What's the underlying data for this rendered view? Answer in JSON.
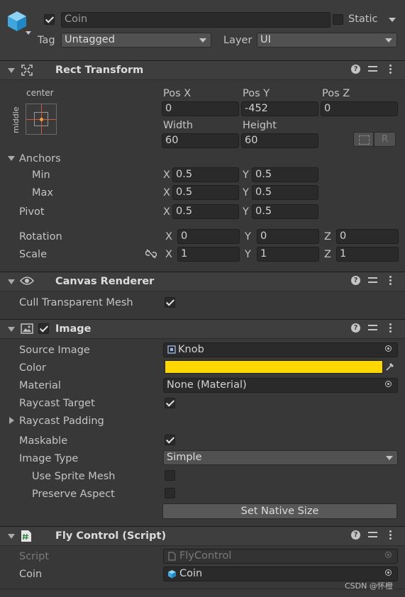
{
  "object": {
    "name": "Coin",
    "static_label": "Static",
    "tag_label": "Tag",
    "tag_value": "Untagged",
    "layer_label": "Layer",
    "layer_value": "UI"
  },
  "rect_transform": {
    "title": "Rect Transform",
    "anchor_preset_h": "center",
    "anchor_preset_v": "middle",
    "pos_x_label": "Pos X",
    "pos_x": "0",
    "pos_y_label": "Pos Y",
    "pos_y": "-452",
    "pos_z_label": "Pos Z",
    "pos_z": "0",
    "width_label": "Width",
    "width": "60",
    "height_label": "Height",
    "height": "60",
    "raw_edit_label": "R",
    "anchors_label": "Anchors",
    "min_label": "Min",
    "min_x": "0.5",
    "min_y": "0.5",
    "max_label": "Max",
    "max_x": "0.5",
    "max_y": "0.5",
    "pivot_label": "Pivot",
    "pivot_x": "0.5",
    "pivot_y": "0.5",
    "rotation_label": "Rotation",
    "rot_x": "0",
    "rot_y": "0",
    "rot_z": "0",
    "scale_label": "Scale",
    "scale_x": "1",
    "scale_y": "1",
    "scale_z": "1",
    "x": "X",
    "y": "Y",
    "z": "Z"
  },
  "canvas_renderer": {
    "title": "Canvas Renderer",
    "cull_label": "Cull Transparent Mesh"
  },
  "image": {
    "title": "Image",
    "source_label": "Source Image",
    "source_value": "Knob",
    "color_label": "Color",
    "color_value": "#FFD700",
    "material_label": "Material",
    "material_value": "None (Material)",
    "raycast_target_label": "Raycast Target",
    "raycast_padding_label": "Raycast Padding",
    "maskable_label": "Maskable",
    "image_type_label": "Image Type",
    "image_type_value": "Simple",
    "use_sprite_mesh_label": "Use Sprite Mesh",
    "preserve_aspect_label": "Preserve Aspect",
    "set_native_size_label": "Set Native Size"
  },
  "fly_control": {
    "title": "Fly Control (Script)",
    "script_label": "Script",
    "script_value": "FlyControl",
    "coin_label": "Coin",
    "coin_value": "Coin"
  },
  "watermark": "CSDN @怀橙"
}
